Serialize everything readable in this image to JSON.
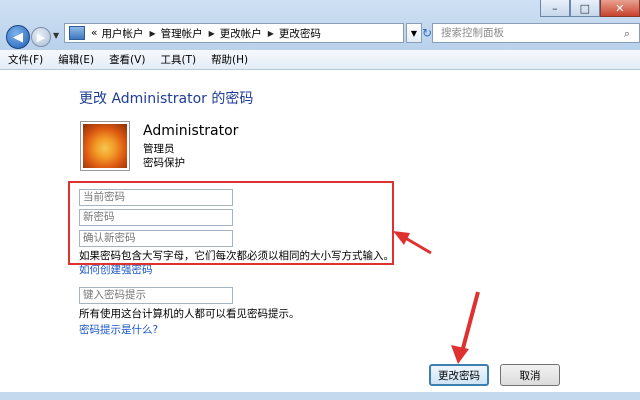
{
  "window": {
    "minimize": "–",
    "maximize": "□",
    "close": "✕"
  },
  "nav": {
    "back_icon": "back-arrow-icon",
    "forward_icon": "forward-arrow-icon"
  },
  "address": {
    "prefix": "«",
    "crumbs": [
      "用户帐户",
      "管理帐户",
      "更改帐户",
      "更改密码"
    ]
  },
  "search": {
    "placeholder": "搜索控制面板"
  },
  "menu": [
    "文件(F)",
    "编辑(E)",
    "查看(V)",
    "工具(T)",
    "帮助(H)"
  ],
  "page": {
    "heading": "更改 Administrator 的密码"
  },
  "user": {
    "name": "Administrator",
    "role": "管理员",
    "status": "密码保护"
  },
  "form": {
    "current_password_placeholder": "当前密码",
    "new_password_placeholder": "新密码",
    "confirm_password_placeholder": "确认新密码",
    "case_hint": "如果密码包含大写字母，它们每次都必须以相同的大小写方式输入。",
    "strong_password_link": "如何创建强密码",
    "password_hint_placeholder": "键入密码提示",
    "hint_visibility_note": "所有使用这台计算机的人都可以看见密码提示。",
    "what_is_hint_link": "密码提示是什么?"
  },
  "buttons": {
    "change_password": "更改密码",
    "cancel": "取消"
  },
  "colors": {
    "heading": "#1e3c98",
    "link": "#1a56c8",
    "annotation": "#e03131"
  }
}
